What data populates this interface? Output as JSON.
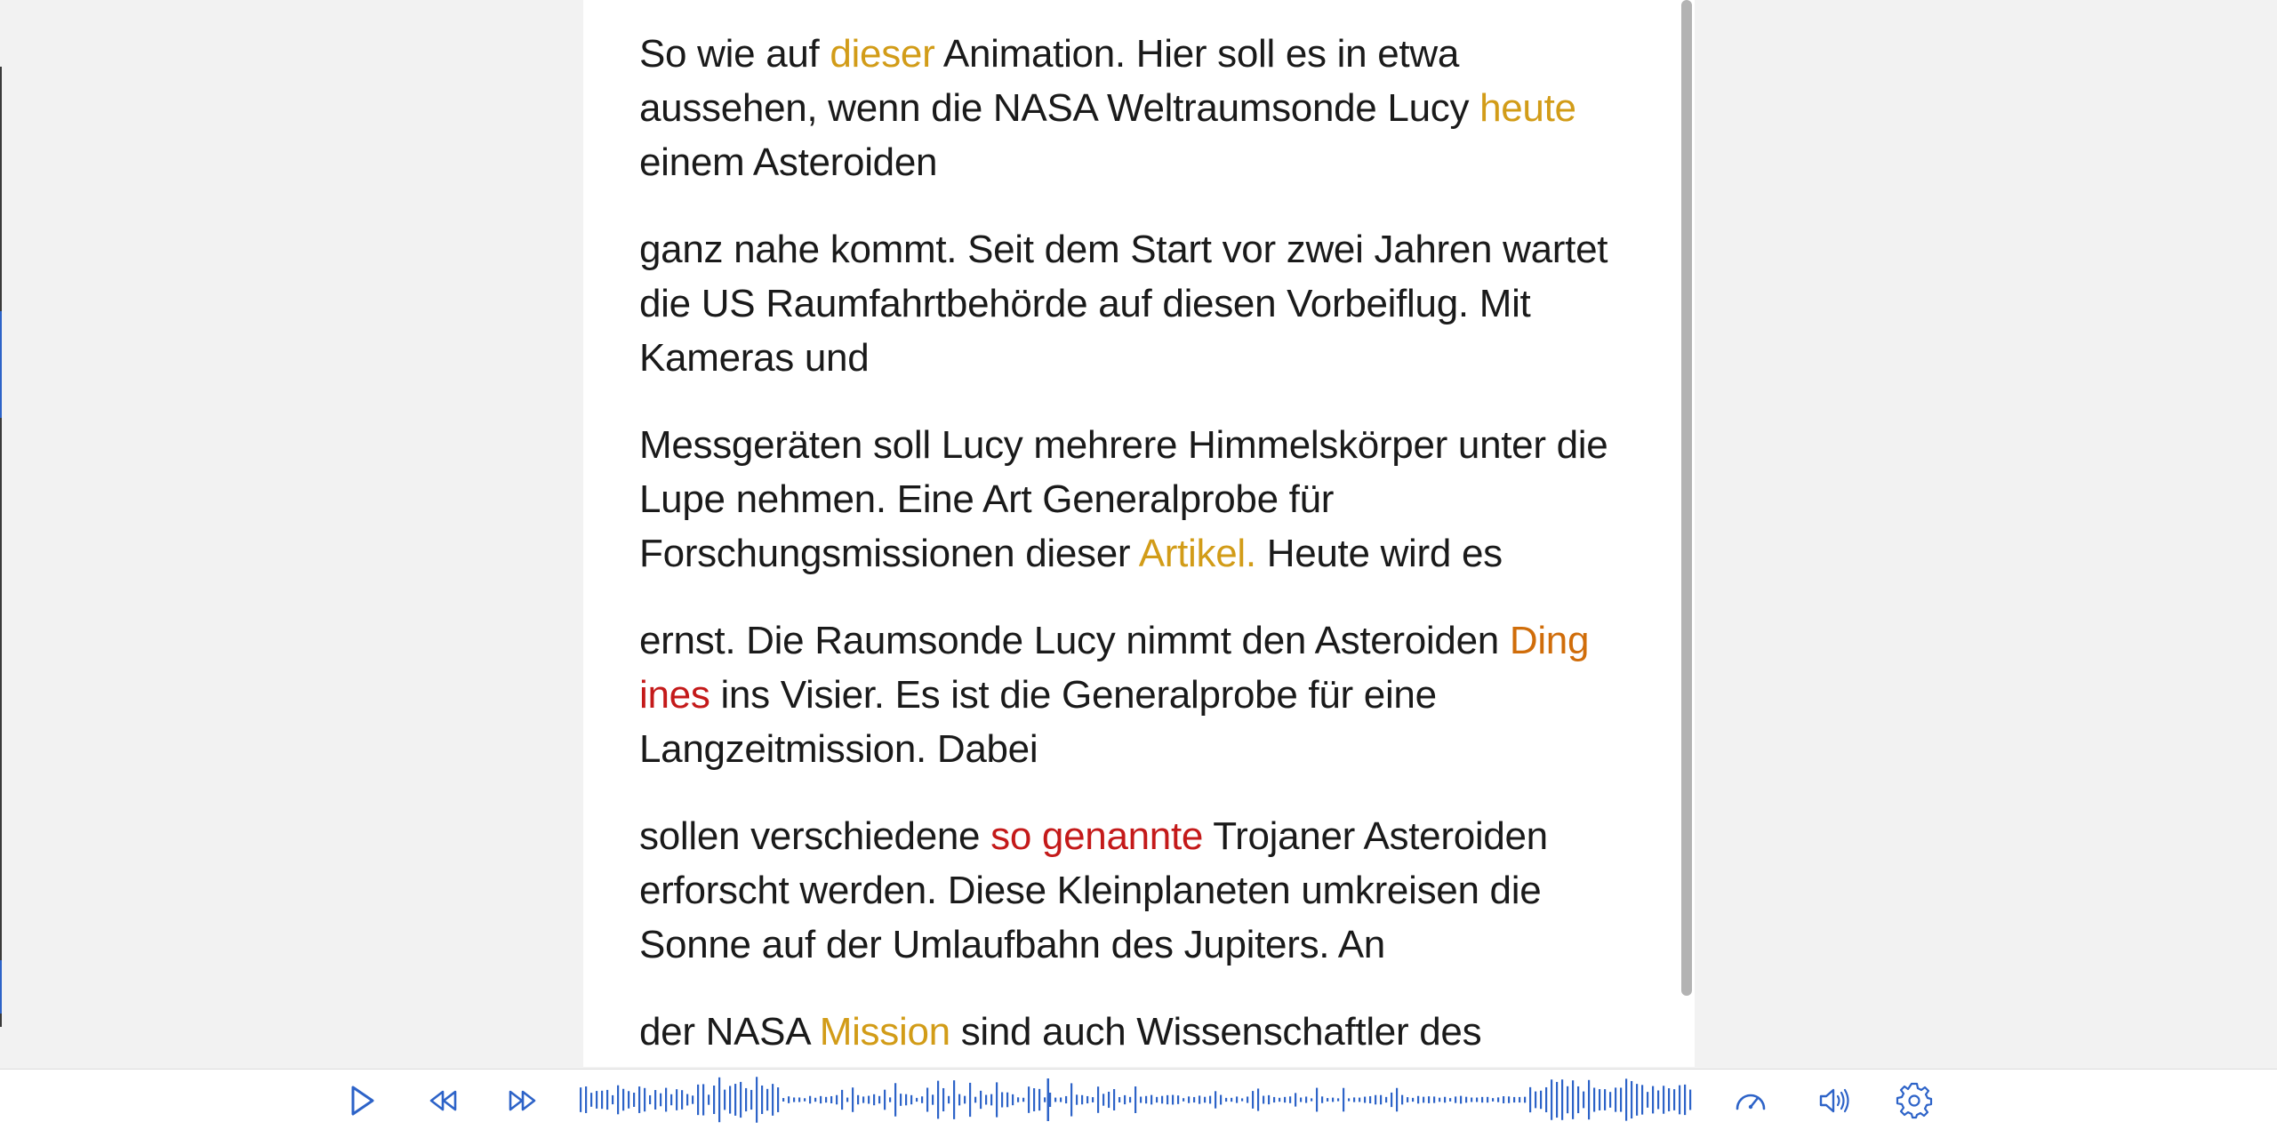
{
  "transcript": {
    "paragraphs": [
      [
        {
          "t": "So wie auf ",
          "c": ""
        },
        {
          "t": "dieser",
          "c": "gold"
        },
        {
          "t": " Animation. Hier soll es in etwa aussehen, wenn die NASA Weltraumsonde Lucy ",
          "c": ""
        },
        {
          "t": "heute",
          "c": "gold"
        },
        {
          "t": " einem Asteroiden",
          "c": ""
        }
      ],
      [
        {
          "t": "ganz nahe kommt. Seit dem Start vor zwei Jahren wartet die US Raumfahrtbehörde auf diesen Vorbeiflug. Mit Kameras und",
          "c": ""
        }
      ],
      [
        {
          "t": "Messgeräten soll Lucy mehrere Himmelskörper unter die Lupe nehmen. Eine Art Generalprobe für Forschungsmissionen dieser ",
          "c": ""
        },
        {
          "t": "Artikel.",
          "c": "gold"
        },
        {
          "t": " Heute wird es",
          "c": ""
        }
      ],
      [
        {
          "t": "ernst. Die Raumsonde Lucy nimmt den Asteroiden ",
          "c": ""
        },
        {
          "t": "Ding",
          "c": "orange"
        },
        {
          "t": " ",
          "c": ""
        },
        {
          "t": "ines",
          "c": "red"
        },
        {
          "t": " ins Visier. Es ist die Generalprobe für eine Langzeitmission. Dabei",
          "c": ""
        }
      ],
      [
        {
          "t": "sollen verschiedene ",
          "c": ""
        },
        {
          "t": "so genannte",
          "c": "red"
        },
        {
          "t": " Trojaner Asteroiden erforscht werden. Diese Kleinplaneten umkreisen die Sonne auf der Umlaufbahn des Jupiters. An",
          "c": ""
        }
      ],
      [
        {
          "t": "der NASA ",
          "c": ""
        },
        {
          "t": "Mission",
          "c": "gold"
        },
        {
          "t": " sind auch Wissenschaftler des",
          "c": ""
        }
      ]
    ]
  },
  "player": {
    "controls": [
      {
        "name": "play-icon"
      },
      {
        "name": "rewind-icon"
      },
      {
        "name": "fast-forward-icon"
      }
    ],
    "right_controls": [
      {
        "name": "speed-gauge-icon"
      },
      {
        "name": "volume-icon"
      },
      {
        "name": "settings-gear-icon"
      }
    ],
    "accent_color": "#2d63c8",
    "playhead_position": 0.42
  },
  "colors": {
    "gold": "#d29c18",
    "orange": "#d06d0a",
    "red": "#c41a1a"
  }
}
